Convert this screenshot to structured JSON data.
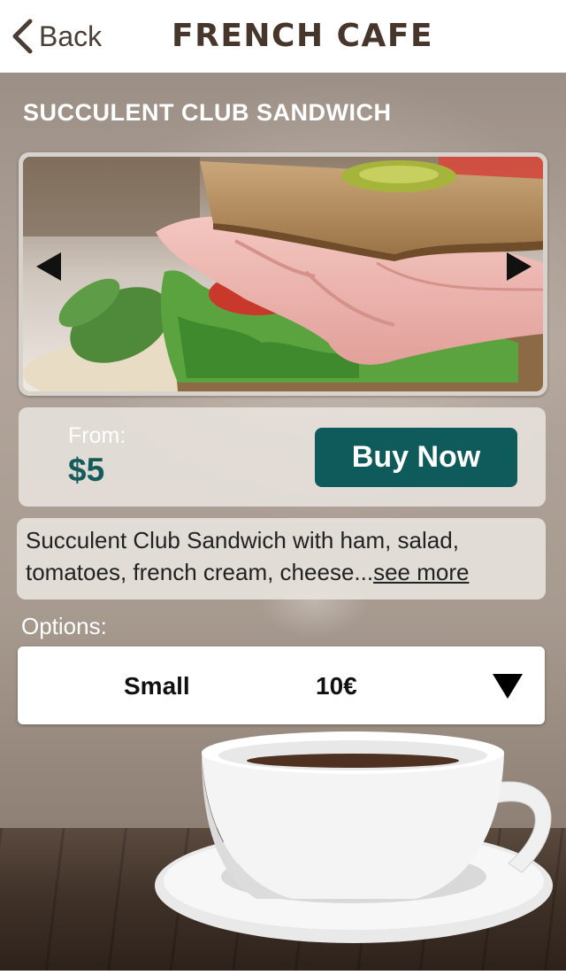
{
  "header": {
    "back_label": "Back",
    "title": "FRENCH CAFE"
  },
  "product": {
    "title": "SUCCULENT CLUB SANDWICH",
    "from_label": "From:",
    "price": "$5",
    "buy_label": "Buy Now",
    "description": "Succulent Club Sandwich with ham, salad, tomatoes, french cream, cheese...",
    "see_more_label": "see more"
  },
  "options": {
    "label": "Options:",
    "selected_size": "Small",
    "selected_price": "10€"
  },
  "colors": {
    "accent": "#0f5a5a",
    "price_text": "#145b5b",
    "title_brown": "#47362b"
  },
  "icons": {
    "back": "chevron-left-icon",
    "prev": "triangle-left-icon",
    "next": "triangle-right-icon",
    "dropdown": "triangle-down-icon"
  }
}
